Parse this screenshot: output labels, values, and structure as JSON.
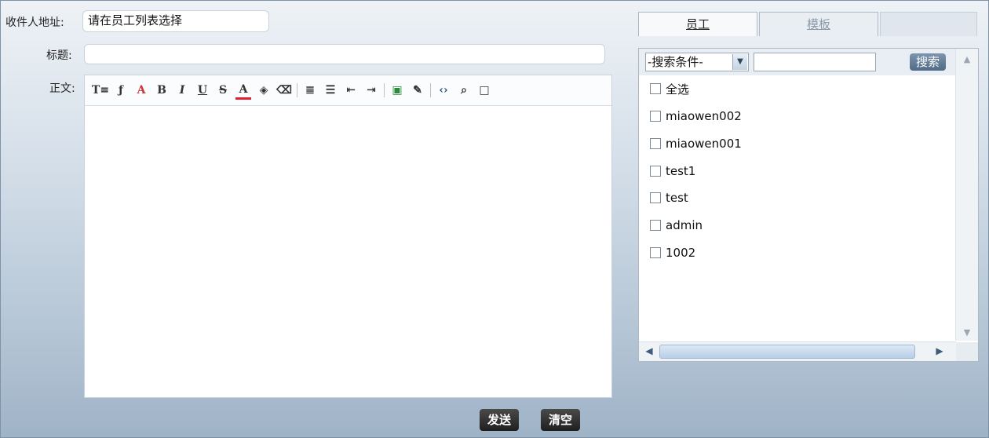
{
  "form": {
    "recipient_label": "收件人地址:",
    "recipient_value": "请在员工列表选择",
    "subject_label": "标题:",
    "subject_value": "",
    "body_label": "正文:"
  },
  "editor": {
    "toolbar": [
      {
        "name": "font-size-icon",
        "glyph": "T≡"
      },
      {
        "name": "font-family-icon",
        "glyph": "ƒ"
      },
      {
        "name": "text-style-icon",
        "glyph": "A"
      },
      {
        "name": "bold-icon",
        "glyph": "B"
      },
      {
        "name": "italic-icon",
        "glyph": "I"
      },
      {
        "name": "underline-icon",
        "glyph": "U"
      },
      {
        "name": "strikethrough-icon",
        "glyph": "S"
      },
      {
        "name": "font-color-icon",
        "glyph": "A"
      },
      {
        "name": "highlight-color-icon",
        "glyph": "◈"
      },
      {
        "name": "eraser-icon",
        "glyph": "⌫"
      },
      {
        "name": "separator",
        "glyph": ""
      },
      {
        "name": "ordered-list-icon",
        "glyph": "≣"
      },
      {
        "name": "unordered-list-icon",
        "glyph": "☰"
      },
      {
        "name": "outdent-icon",
        "glyph": "⇤"
      },
      {
        "name": "indent-icon",
        "glyph": "⇥"
      },
      {
        "name": "separator",
        "glyph": ""
      },
      {
        "name": "insert-image-icon",
        "glyph": "▣"
      },
      {
        "name": "edit-icon",
        "glyph": "✎"
      },
      {
        "name": "separator",
        "glyph": ""
      },
      {
        "name": "source-code-icon",
        "glyph": "‹›"
      },
      {
        "name": "preview-icon",
        "glyph": "⌕"
      },
      {
        "name": "fullscreen-icon",
        "glyph": "□"
      }
    ]
  },
  "actions": {
    "send_label": "发送",
    "clear_label": "清空"
  },
  "tabs": [
    {
      "label": "员工",
      "active": true
    },
    {
      "label": "模板",
      "active": false
    }
  ],
  "search": {
    "select_value": "-搜索条件-",
    "input_value": "",
    "button_label": "搜索"
  },
  "employees": [
    "全选",
    "miaowen002",
    "miaowen001",
    "test1",
    "test",
    "admin",
    "1002"
  ],
  "colors": {
    "button_dark": "#2a2a2a",
    "search_button": "#5f7a96",
    "panel_border": "#aeb9c5"
  }
}
